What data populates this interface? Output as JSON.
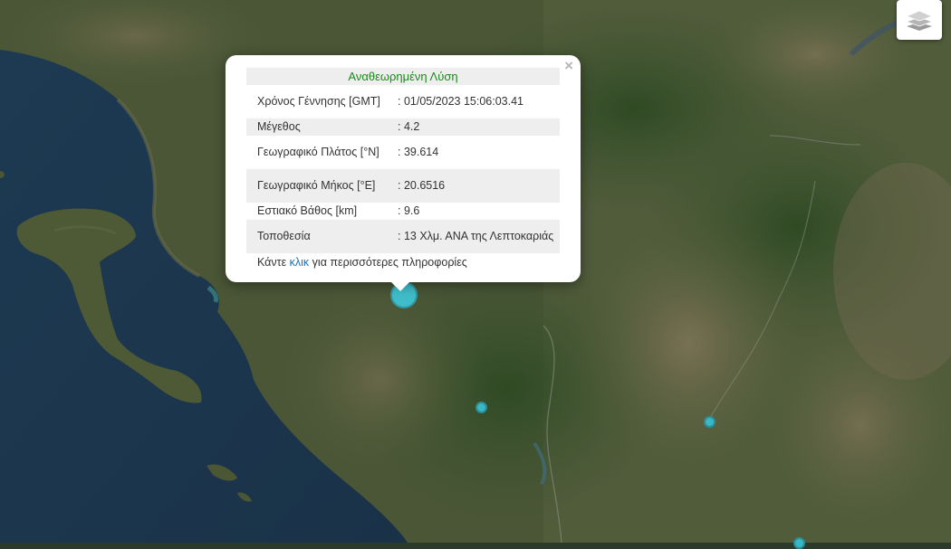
{
  "popup": {
    "title": "Αναθεωρημένη Λύση",
    "close": "×",
    "rows": [
      {
        "label": "Χρόνος Γέννησης [GMT]",
        "value": ": 01/05/2023 15:06:03.41"
      },
      {
        "label": "Μέγεθος",
        "value": ": 4.2"
      },
      {
        "label": "Γεωγραφικό Πλάτος [°N]",
        "value": ": 39.614"
      },
      {
        "label": "Γεωγραφικό Μήκος [°E]",
        "value": ": 20.6516"
      },
      {
        "label": "Εστιακό Βάθος [km]",
        "value": ": 9.6"
      },
      {
        "label": "Τοποθεσία",
        "value": ": 13 Χλμ. ΑΝΑ της Λεπτοκαριάς"
      }
    ],
    "footer_prefix": "Κάντε ",
    "footer_link": "κλικ",
    "footer_suffix": " για περισσότερες πληροφορίες"
  },
  "controls": {
    "layers_icon": "layers-icon"
  },
  "colors": {
    "marker": "#3ab7c4",
    "title_green": "#1a8a1a",
    "link_blue": "#1f6fb0"
  }
}
